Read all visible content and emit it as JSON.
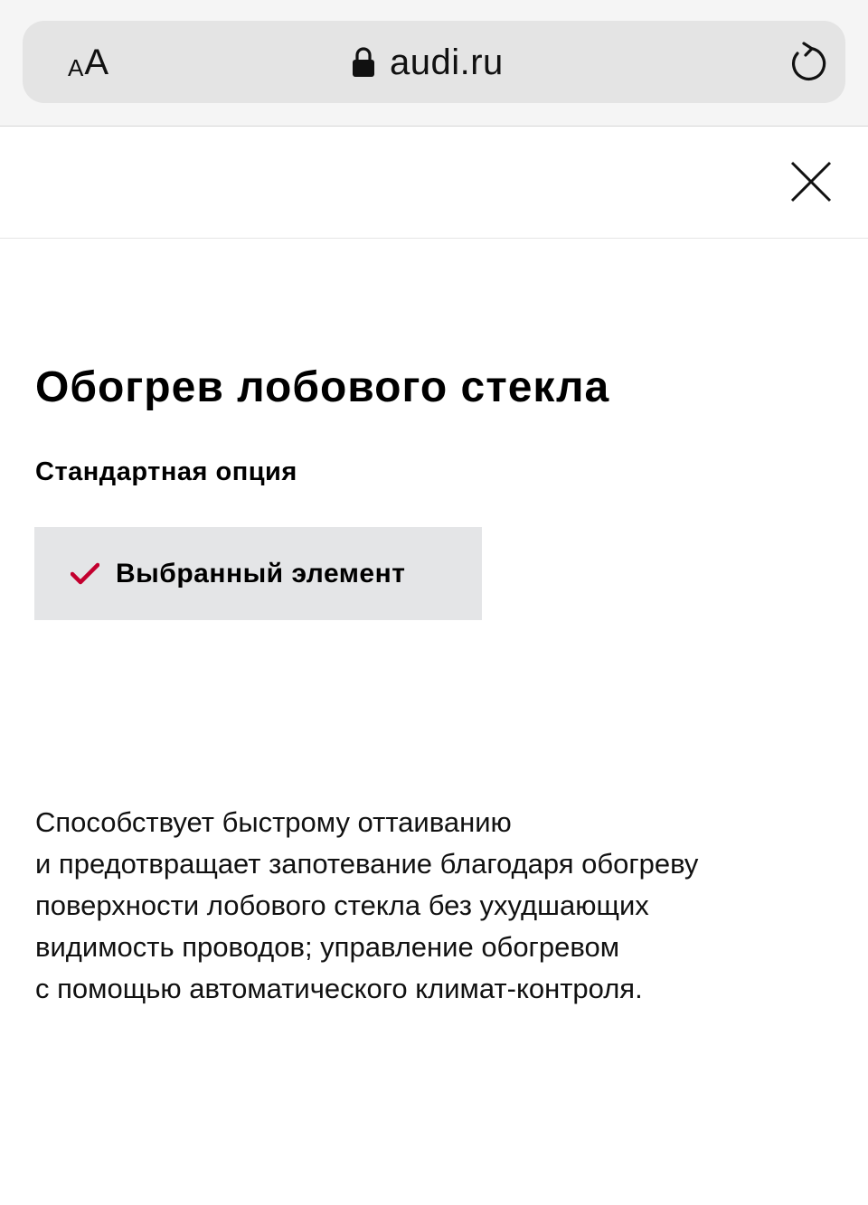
{
  "browser": {
    "aa_small": "A",
    "aa_large": "A",
    "url": "audi.ru",
    "icons": {
      "lock": "lock-icon",
      "reload": "reload-icon"
    }
  },
  "modal": {
    "close_icon": "close-icon",
    "title": "Обогрев лобового стекла",
    "option_type": "Стандартная опция",
    "selected_button": {
      "label": "Выбранный элемент",
      "icon": "check-icon",
      "check_color": "#c3002f"
    },
    "description_lines": [
      "Способствует быстрому оттаиванию",
      "и предотвращает запотевание благодаря обогреву",
      "поверхности лобового стекла без ухудшающих",
      "видимость проводов; управление обогревом",
      "с помощью автоматического климат-контроля."
    ]
  },
  "colors": {
    "address_bar": "#e4e4e4",
    "button_background": "#e4e5e7",
    "accent": "#c3002f"
  }
}
